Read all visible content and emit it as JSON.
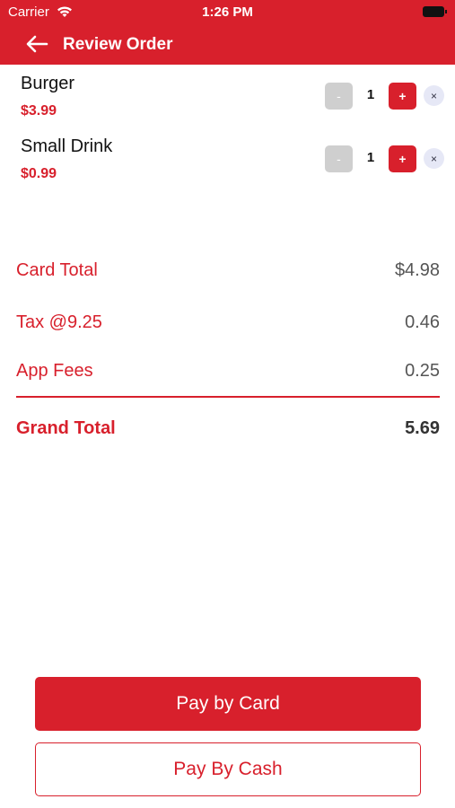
{
  "status_bar": {
    "carrier": "Carrier",
    "time": "1:26 PM"
  },
  "nav": {
    "title": "Review Order"
  },
  "items": [
    {
      "name": "Burger",
      "price": "$3.99",
      "quantity": "1",
      "minus": "-",
      "plus": "+",
      "remove": "×"
    },
    {
      "name": "Small Drink",
      "price": "$0.99",
      "quantity": "1",
      "minus": "-",
      "plus": "+",
      "remove": "×"
    }
  ],
  "summary": {
    "card_total_label": "Card Total",
    "card_total_value": "$4.98",
    "tax_label": "Tax @9.25",
    "tax_value": "0.46",
    "app_fees_label": "App Fees",
    "app_fees_value": "0.25",
    "grand_total_label": "Grand Total",
    "grand_total_value": "5.69"
  },
  "buttons": {
    "pay_card": "Pay by Card",
    "pay_cash": "Pay By Cash"
  },
  "colors": {
    "accent": "#d8202c"
  }
}
